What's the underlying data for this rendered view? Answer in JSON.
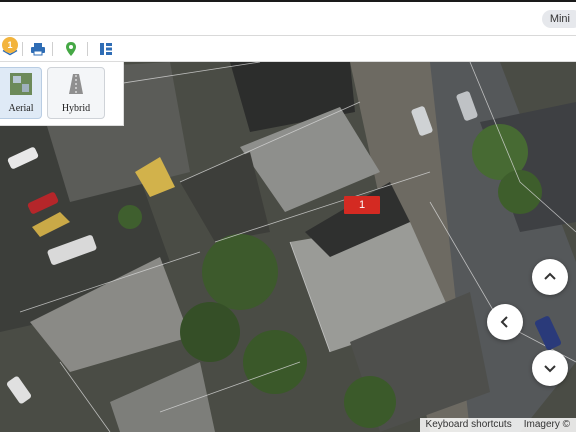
{
  "header": {
    "pill_label": "Mini"
  },
  "toolbar": {
    "layers_badge": "1",
    "icons": [
      "layers-icon",
      "print-icon",
      "location-pin-icon",
      "list-panel-icon"
    ]
  },
  "basemap_switcher": {
    "options": [
      {
        "label": "Aerial",
        "selected": true
      },
      {
        "label": "Hybrid",
        "selected": false
      }
    ]
  },
  "map": {
    "marker_label": "1",
    "marker_color": "#d42a22"
  },
  "controls": {
    "icons": [
      "pan-up-icon",
      "pan-left-icon",
      "pan-down-icon"
    ]
  },
  "attribution": {
    "shortcuts": "Keyboard shortcuts",
    "imagery": "Imagery ©"
  }
}
